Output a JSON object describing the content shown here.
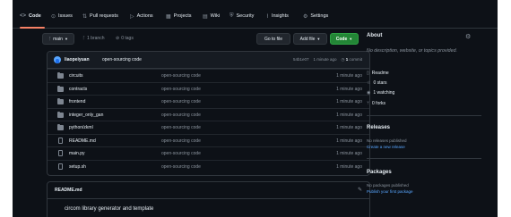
{
  "nav": {
    "items": [
      {
        "label": "Code",
        "icon": "code-icon",
        "glyph": "<>"
      },
      {
        "label": "Issues",
        "icon": "issue-icon",
        "glyph": "⊙"
      },
      {
        "label": "Pull requests",
        "icon": "pull-request-icon",
        "glyph": "⇅"
      },
      {
        "label": "Actions",
        "icon": "actions-icon",
        "glyph": "▷"
      },
      {
        "label": "Projects",
        "icon": "projects-icon",
        "glyph": "▦"
      },
      {
        "label": "Wiki",
        "icon": "wiki-icon",
        "glyph": "▤"
      },
      {
        "label": "Security",
        "icon": "shield-icon",
        "glyph": "⛨"
      },
      {
        "label": "Insights",
        "icon": "graph-icon",
        "glyph": "⌇"
      },
      {
        "label": "Settings",
        "icon": "gear-icon",
        "glyph": "⚙"
      }
    ],
    "active": "Code",
    "accent": "#f78166"
  },
  "toolbar": {
    "branch": "main",
    "branches": "1 branch",
    "tags": "0 tags",
    "goto": "Go to file",
    "addfile": "Add file",
    "code": "Code"
  },
  "commit": {
    "author": "liaopeiyuan",
    "message": "open-sourcing code",
    "hash": "54b1e07",
    "time": "1 minute ago",
    "commits": "1",
    "commits_label": "commit"
  },
  "files": [
    {
      "name": "circuits",
      "type": "dir",
      "message": "open-sourcing code",
      "age": "1 minute ago"
    },
    {
      "name": "contracts",
      "type": "dir",
      "message": "open-sourcing code",
      "age": "1 minute ago"
    },
    {
      "name": "frontend",
      "type": "dir",
      "message": "open-sourcing code",
      "age": "1 minute ago"
    },
    {
      "name": "integer_only_gan",
      "type": "dir",
      "message": "open-sourcing code",
      "age": "1 minute ago"
    },
    {
      "name": "python/zkml",
      "type": "dir",
      "message": "open-sourcing code",
      "age": "1 minute ago"
    },
    {
      "name": "README.md",
      "type": "file",
      "message": "open-sourcing code",
      "age": "1 minute ago"
    },
    {
      "name": "main.py",
      "type": "file",
      "message": "open-sourcing code",
      "age": "1 minute ago"
    },
    {
      "name": "setup.sh",
      "type": "file",
      "message": "open-sourcing code",
      "age": "1 minute ago"
    }
  ],
  "readme": {
    "title": "README.md",
    "text": "circom library generator and template"
  },
  "about": {
    "title": "About",
    "description": "No description, website, or topics provided.",
    "readme": "Readme",
    "stars": "0 stars",
    "watching": "1 watching",
    "forks": "0 forks"
  },
  "releases": {
    "title": "Releases",
    "none": "No releases published",
    "create": "Create a new release"
  },
  "packages": {
    "title": "Packages",
    "none": "No packages published",
    "publish": "Publish your first package"
  },
  "colors": {
    "background": "#0d1117",
    "border": "#30363d",
    "green_button": "#238636",
    "link": "#58a6ff"
  }
}
